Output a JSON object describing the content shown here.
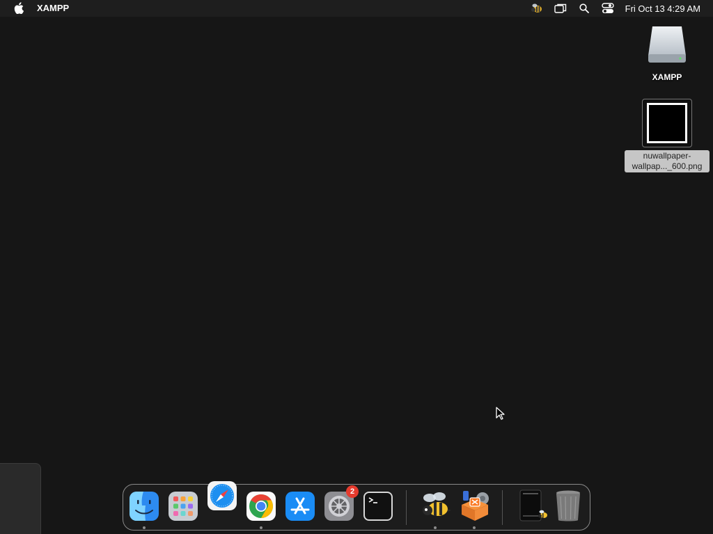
{
  "menubar": {
    "app_name": "XAMPP",
    "clock": "Fri Oct 13  4:29 AM",
    "status_icons": [
      "hornet-app-icon",
      "screen-mirroring-icon",
      "search-icon",
      "control-center-icon"
    ]
  },
  "desktop": {
    "drive": {
      "label": "XAMPP",
      "icon": "external-drive-icon"
    },
    "file": {
      "label_line1": "nuwallpaper-",
      "label_line2": "wallpap..._600.png",
      "icon": "image-file-icon"
    }
  },
  "dock": {
    "apps": [
      {
        "name": "Finder",
        "icon": "finder-icon",
        "running": true
      },
      {
        "name": "Launchpad",
        "icon": "launchpad-icon",
        "running": false
      },
      {
        "name": "Safari",
        "icon": "safari-icon",
        "running": false
      },
      {
        "name": "Google Chrome",
        "icon": "chrome-icon",
        "running": true
      },
      {
        "name": "App Store",
        "icon": "app-store-icon",
        "running": false
      },
      {
        "name": "System Settings",
        "icon": "system-settings-icon",
        "running": false,
        "badge": "2"
      },
      {
        "name": "Terminal",
        "icon": "terminal-icon",
        "running": false
      },
      {
        "name": "Hornet",
        "icon": "bee-icon",
        "running": true
      },
      {
        "name": "XAMPP",
        "icon": "xampp-icon",
        "running": true
      },
      {
        "name": "Downloads Stack",
        "icon": "stack-icon",
        "running": false
      },
      {
        "name": "Trash",
        "icon": "trash-icon",
        "running": false
      }
    ]
  }
}
